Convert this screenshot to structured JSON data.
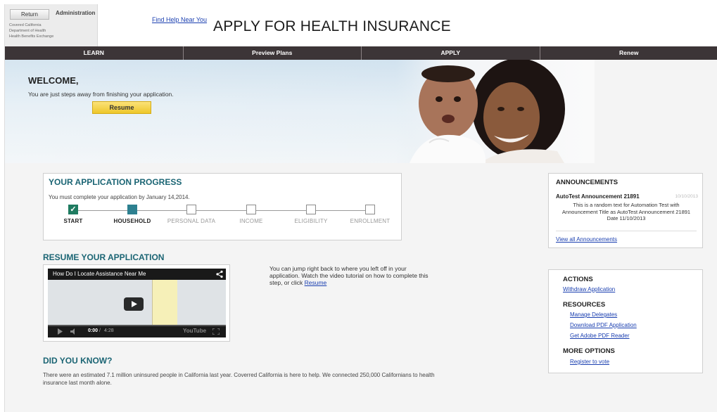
{
  "header": {
    "return_label": "Return",
    "admin_label": "Administration",
    "org_lines": [
      "Covered California",
      "Department of Health",
      "Health Benefits Exchange"
    ],
    "find_help": "Find Help Near You",
    "title": "APPLY FOR HEALTH INSURANCE"
  },
  "nav": {
    "items": [
      {
        "label": "LEARN"
      },
      {
        "label": "Preview Plans"
      },
      {
        "label": "APPLY"
      },
      {
        "label": "Renew"
      }
    ]
  },
  "hero": {
    "welcome": "WELCOME,",
    "subtitle": "You are just steps away from finishing your application.",
    "resume_label": "Resume"
  },
  "progress": {
    "title": "YOUR APPLICATION PROGRESS",
    "deadline": "You must complete your application by January 14,2014.",
    "steps": [
      {
        "label": "START",
        "state": "done"
      },
      {
        "label": "HOUSEHOLD",
        "state": "current"
      },
      {
        "label": "PERSONAL DATA",
        "state": "todo"
      },
      {
        "label": "INCOME",
        "state": "todo"
      },
      {
        "label": "ELIGIBILITY",
        "state": "todo"
      },
      {
        "label": "ENROLLMENT",
        "state": "todo"
      }
    ]
  },
  "resume_section": {
    "title": "RESUME YOUR APPLICATION",
    "video": {
      "title": "How Do I Locate Assistance Near Me",
      "time_current": "0:00",
      "time_sep": "/",
      "time_total": "4:28",
      "logo": "YouTube"
    },
    "description": "You can jump right back to where you left off in your application. Watch the video tutorial on how to complete this step, or click",
    "link_label": "Resume"
  },
  "did_you_know": {
    "title": "DID YOU KNOW?",
    "text": "There were an estimated 7.1 million uninsured people in California last year. Coverred California is here to help. We connected 250,000 Californians to health insurance last month alone."
  },
  "announcements": {
    "title": "ANNOUNCEMENTS",
    "item_title": "AutoTest Announcement 21891",
    "item_date": "10/10/2013",
    "item_body": "This is a random text for Automation Test with Announcement Title as AutoTest Announcement 21891 Date 11/10/2013",
    "view_all": "View all Announcements"
  },
  "actions": {
    "actions_title": "ACTIONS",
    "withdraw": "Withdraw Application",
    "resources_title": "RESOURCES",
    "manage_delegates": "Manage Delegates",
    "download_pdf": "Download PDF Application",
    "adobe_reader": "Get Adobe PDF Reader",
    "more_title": "MORE OPTIONS",
    "register_vote": "Register to vote"
  },
  "colors": {
    "nav_bg": "#3c3537",
    "section_heading": "#1b6574",
    "link": "#1a3fb0",
    "resume_button": "#f2cf3e",
    "step_done": "#1e7b60",
    "step_current": "#2d8090"
  }
}
